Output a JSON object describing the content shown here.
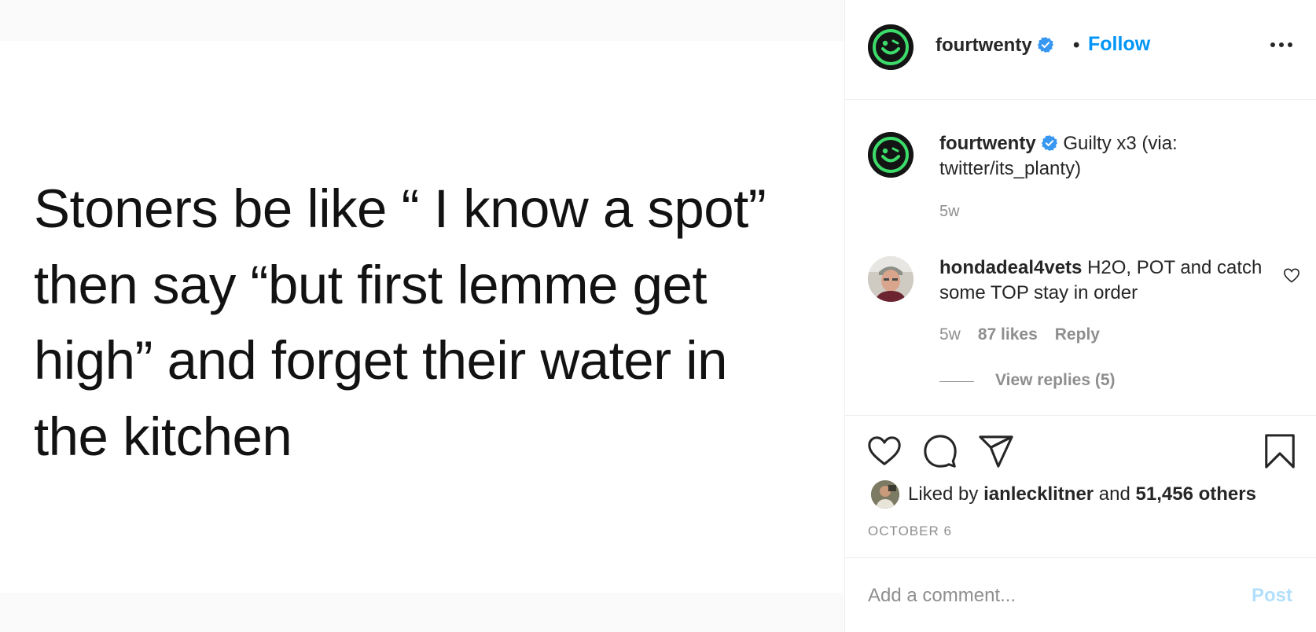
{
  "post": {
    "image_text": "Stoners be like “ I know a spot”\nthen say “but first lemme get\nhigh” and forget their water in\nthe kitchen"
  },
  "header": {
    "username": "fourtwenty",
    "separator": "•",
    "follow_label": "Follow",
    "more_icon": "more-options-icon"
  },
  "caption": {
    "username": "fourtwenty",
    "text": "Guilty x3 (via: twitter/its_planty)",
    "time": "5w"
  },
  "comments": [
    {
      "username": "hondadeal4vets",
      "text": "H2O, POT and catch some TOP stay in order",
      "time": "5w",
      "likes": "87 likes",
      "reply_label": "Reply",
      "view_replies": "View replies (5)"
    }
  ],
  "likes": {
    "prefix": "Liked by",
    "user": "ianlecklitner",
    "and": "and",
    "others": "51,456 others"
  },
  "date": "OCTOBER 6",
  "comment_box": {
    "placeholder": "Add a comment...",
    "post_label": "Post"
  },
  "colors": {
    "accent": "#0095f6",
    "verified": "#3897f0",
    "brand_green": "#3ddc6a",
    "muted": "#8e8e8e"
  }
}
